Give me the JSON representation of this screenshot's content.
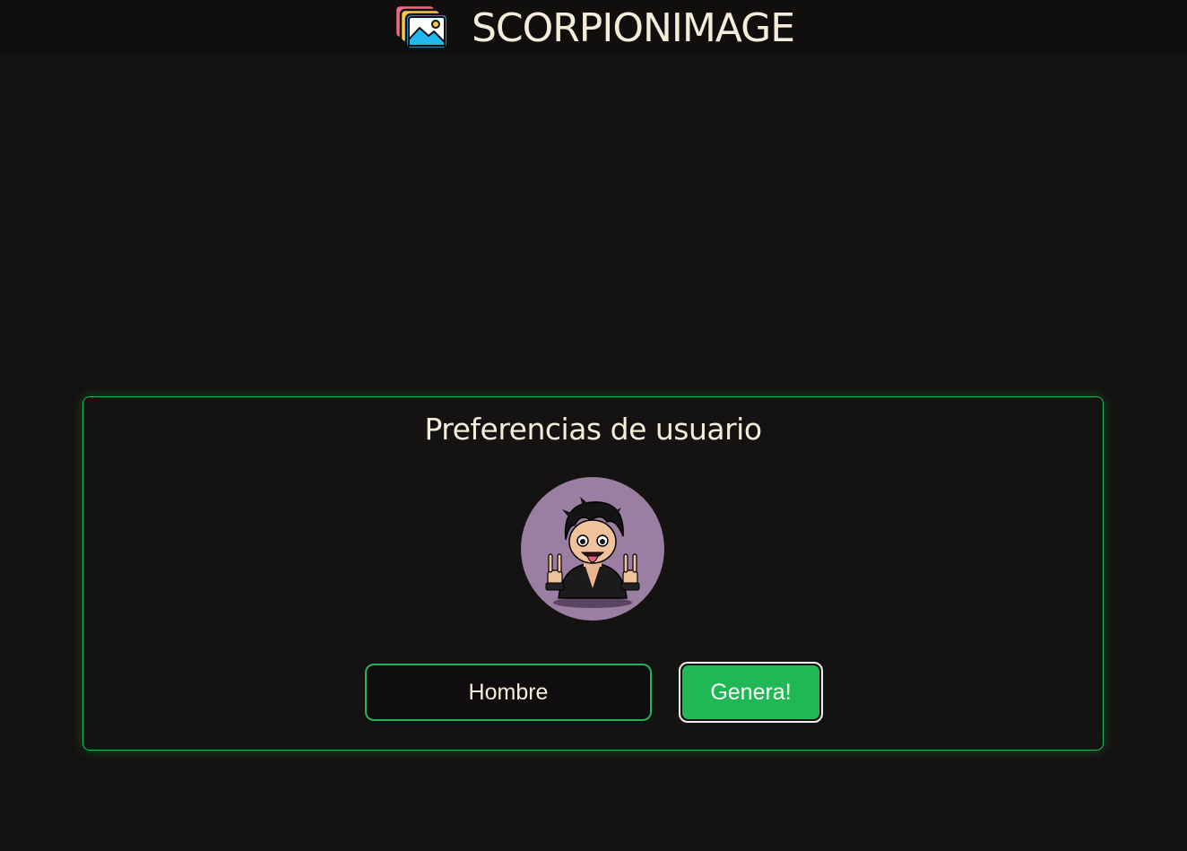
{
  "header": {
    "app_name": "SCORPIONIMAGE",
    "logo_icon": "image-stack-icon"
  },
  "preferences": {
    "title": "Preferencias de usuario",
    "avatar_icon": "cartoon-rocker-avatar",
    "gender_value": "Hombre",
    "generate_label": "Genera!"
  },
  "colors": {
    "background": "#151212",
    "header_background": "#110e0e",
    "accent_green": "#22b455",
    "button_green": "#1fb855",
    "text": "#f5ecd9",
    "avatar_background": "#9a7fa3"
  }
}
